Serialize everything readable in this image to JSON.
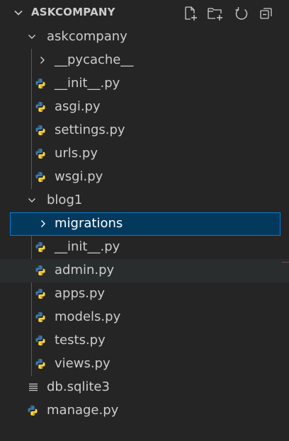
{
  "explorer": {
    "section_title": "ASKCOMPANY",
    "actions": [
      {
        "name": "new-file-icon",
        "label": "New File"
      },
      {
        "name": "new-folder-icon",
        "label": "New Folder"
      },
      {
        "name": "refresh-icon",
        "label": "Refresh Explorer"
      },
      {
        "name": "collapse-all-icon",
        "label": "Collapse Folders in Explorer"
      }
    ]
  },
  "tree": {
    "askcompany_folder": "askcompany",
    "pycache_folder": "__pycache__",
    "askcompany_files": [
      "__init__.py",
      "asgi.py",
      "settings.py",
      "urls.py",
      "wsgi.py"
    ],
    "blog1_folder": "blog1",
    "migrations_folder": "migrations",
    "blog1_files": [
      "__init__.py",
      "admin.py",
      "apps.py",
      "models.py",
      "tests.py",
      "views.py"
    ],
    "root_files": [
      "db.sqlite3",
      "manage.py"
    ]
  },
  "colors": {
    "background": "#252526",
    "selected_bg": "#04395e",
    "selected_border": "#007fd4",
    "python_blue": "#3c78aa",
    "python_yellow": "#ffd43b",
    "text": "#cccccc"
  }
}
